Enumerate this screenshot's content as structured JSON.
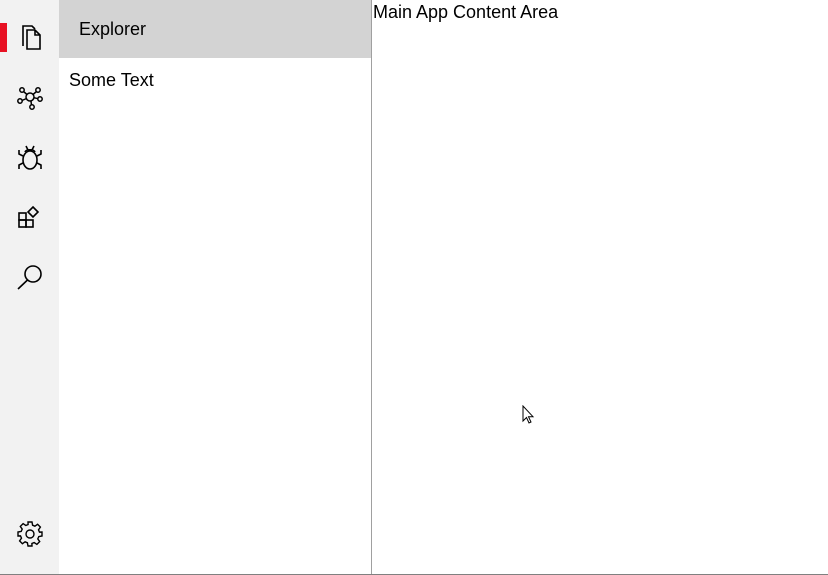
{
  "activity_bar": {
    "items": [
      {
        "name": "explorer",
        "icon": "files-icon",
        "active": true
      },
      {
        "name": "source-control",
        "icon": "network-icon"
      },
      {
        "name": "debug",
        "icon": "bug-icon"
      },
      {
        "name": "extensions",
        "icon": "extensions-icon"
      },
      {
        "name": "search",
        "icon": "search-icon"
      }
    ],
    "settings_icon": "gear-icon",
    "accent_color": "#e81123"
  },
  "panel": {
    "title": "Explorer",
    "body_text": "Some Text"
  },
  "main": {
    "text": "Main App Content Area"
  }
}
